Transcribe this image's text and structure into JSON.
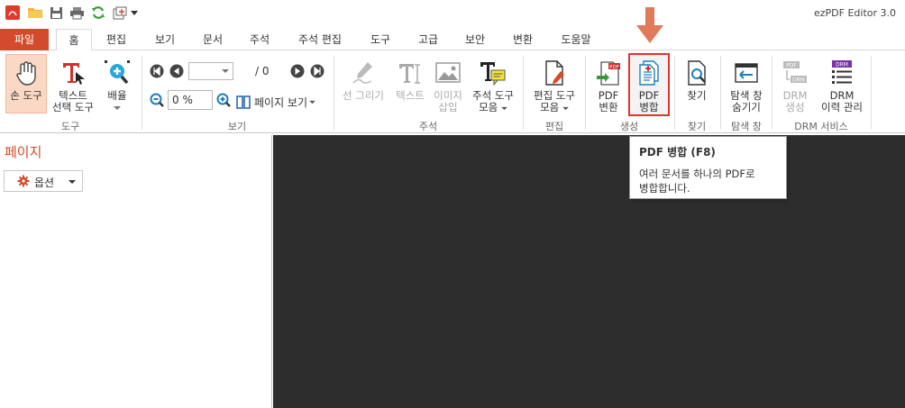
{
  "app": {
    "title": "ezPDF Editor 3.0"
  },
  "tabs": [
    "파일",
    "홈",
    "편집",
    "보기",
    "문서",
    "주석",
    "주석 편집",
    "도구",
    "고급",
    "보안",
    "변환",
    "도움말"
  ],
  "ribbon": {
    "hand_tool": "손 도구",
    "text_select_1": "텍스트",
    "text_select_2": "선택 도구",
    "zoom": "배율",
    "group_tools": "도구",
    "page_total": "/ 0",
    "zoom_value": "0 %",
    "page_view": "페이지 보기",
    "group_view": "보기",
    "line_draw": "선 그리기",
    "text": "텍스트",
    "image_1": "이미지",
    "image_2": "삽입",
    "annot_1": "주석 도구",
    "annot_2": "모음",
    "group_annot": "주석",
    "edit_1": "편집 도구",
    "edit_2": "모음",
    "group_edit": "편집",
    "pdf_convert_1": "PDF",
    "pdf_convert_2": "변환",
    "pdf_merge_1": "PDF",
    "pdf_merge_2": "병합",
    "group_create": "생성",
    "find": "찾기",
    "group_find": "찾기",
    "nav_1": "탐색 창",
    "nav_2": "숨기기",
    "group_nav": "탐색 창",
    "drm_create_1": "DRM",
    "drm_create_2": "생성",
    "drm_history_1": "DRM",
    "drm_history_2": "이력 관리",
    "group_drm": "DRM 서비스"
  },
  "left_panel": {
    "title": "페이지",
    "options": "옵션"
  },
  "tooltip": {
    "title": "PDF 병합 (F8)",
    "desc_1": "여러 문서를 하나의 PDF로",
    "desc_2": "병합합니다."
  },
  "colors": {
    "accent": "#d34b2c",
    "highlight_border": "#e0362f",
    "canvas": "#2d2d2d"
  }
}
